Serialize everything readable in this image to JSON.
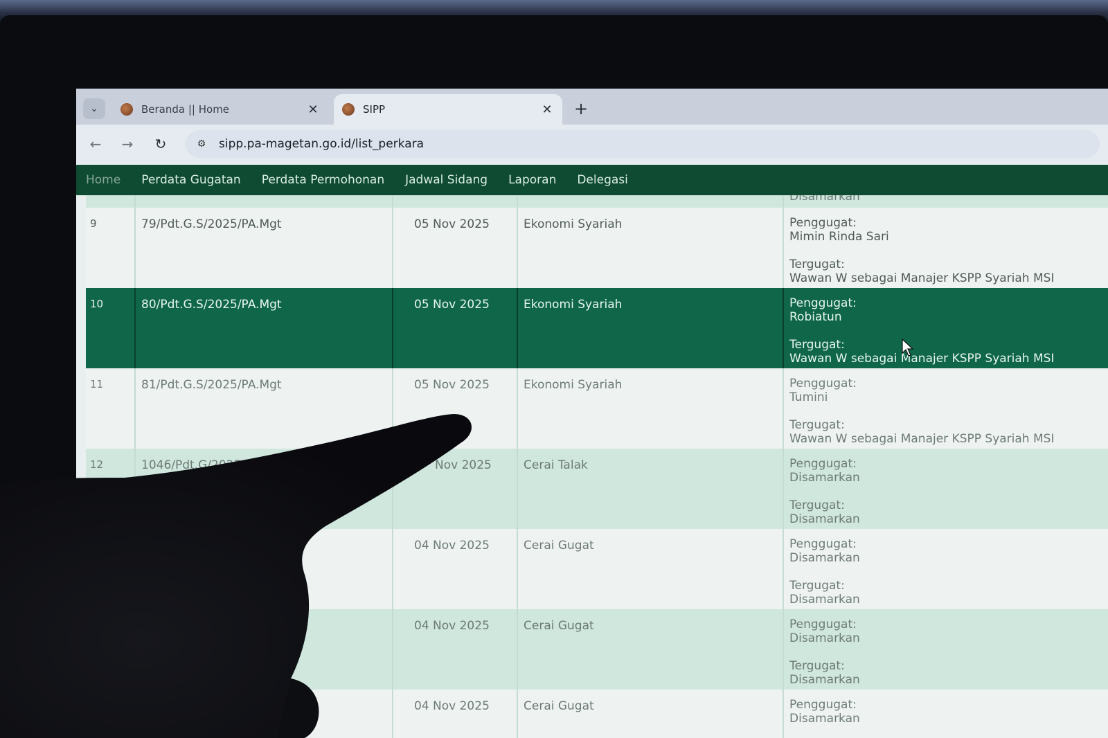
{
  "browser": {
    "tabs": [
      {
        "title": "Beranda || Home",
        "close": "✕"
      },
      {
        "title": "SIPP",
        "close": "✕"
      }
    ],
    "new_tab": "+",
    "menu_chevron": "⌄",
    "nav": {
      "back": "←",
      "forward": "→",
      "reload": "↻"
    },
    "site_icon": "⚙",
    "url": "sipp.pa-magetan.go.id/list_perkara"
  },
  "site_nav": {
    "items": [
      "Home",
      "Perdata Gugatan",
      "Perdata Permohonan",
      "Jadwal Sidang",
      "Laporan",
      "Delegasi"
    ]
  },
  "table": {
    "partial_top": {
      "party_text": "Disamarkan"
    },
    "rows": [
      {
        "no": "9",
        "case": "79/Pdt.G.S/2025/PA.Mgt",
        "date": "05 Nov 2025",
        "type": "Ekonomi Syariah",
        "plaintiff_label": "Penggugat:",
        "plaintiff": "Mimin Rinda Sari",
        "defendant_label": "Tergugat:",
        "defendant": "Wawan W sebagai Manajer KSPP Syariah MSI"
      },
      {
        "no": "10",
        "case": "80/Pdt.G.S/2025/PA.Mgt",
        "date": "05 Nov 2025",
        "type": "Ekonomi Syariah",
        "plaintiff_label": "Penggugat:",
        "plaintiff": "Robiatun",
        "defendant_label": "Tergugat:",
        "defendant": "Wawan W sebagai Manajer KSPP Syariah MSI"
      },
      {
        "no": "11",
        "case": "81/Pdt.G.S/2025/PA.Mgt",
        "date": "05 Nov 2025",
        "type": "Ekonomi Syariah",
        "plaintiff_label": "Penggugat:",
        "plaintiff": "Tumini",
        "defendant_label": "Tergugat:",
        "defendant": "Wawan W sebagai Manajer KSPP Syariah MSI"
      },
      {
        "no": "12",
        "case": "1046/Pdt.G/2025/PA.Mgt",
        "date": "Nov 2025",
        "type": "Cerai Talak",
        "plaintiff_label": "Penggugat:",
        "plaintiff": "Disamarkan",
        "defendant_label": "Tergugat:",
        "defendant": "Disamarkan"
      },
      {
        "no": "",
        "case": "",
        "date": "04 Nov 2025",
        "type": "Cerai Gugat",
        "plaintiff_label": "Penggugat:",
        "plaintiff": "Disamarkan",
        "defendant_label": "Tergugat:",
        "defendant": "Disamarkan"
      },
      {
        "no": "",
        "case": "",
        "date": "04 Nov 2025",
        "type": "Cerai Gugat",
        "plaintiff_label": "Penggugat:",
        "plaintiff": "Disamarkan",
        "defendant_label": "Tergugat:",
        "defendant": "Disamarkan"
      },
      {
        "no": "",
        "case": "",
        "date": "04 Nov 2025",
        "type": "Cerai Gugat",
        "plaintiff_label": "Penggugat:",
        "plaintiff": "Disamarkan",
        "defendant_label": "",
        "defendant": ""
      }
    ]
  },
  "colors": {
    "nav_green": "#0f4a33",
    "highlight_row": "#0f6648",
    "mint_row": "#cfe7dd",
    "light_row": "#eef3f2"
  }
}
